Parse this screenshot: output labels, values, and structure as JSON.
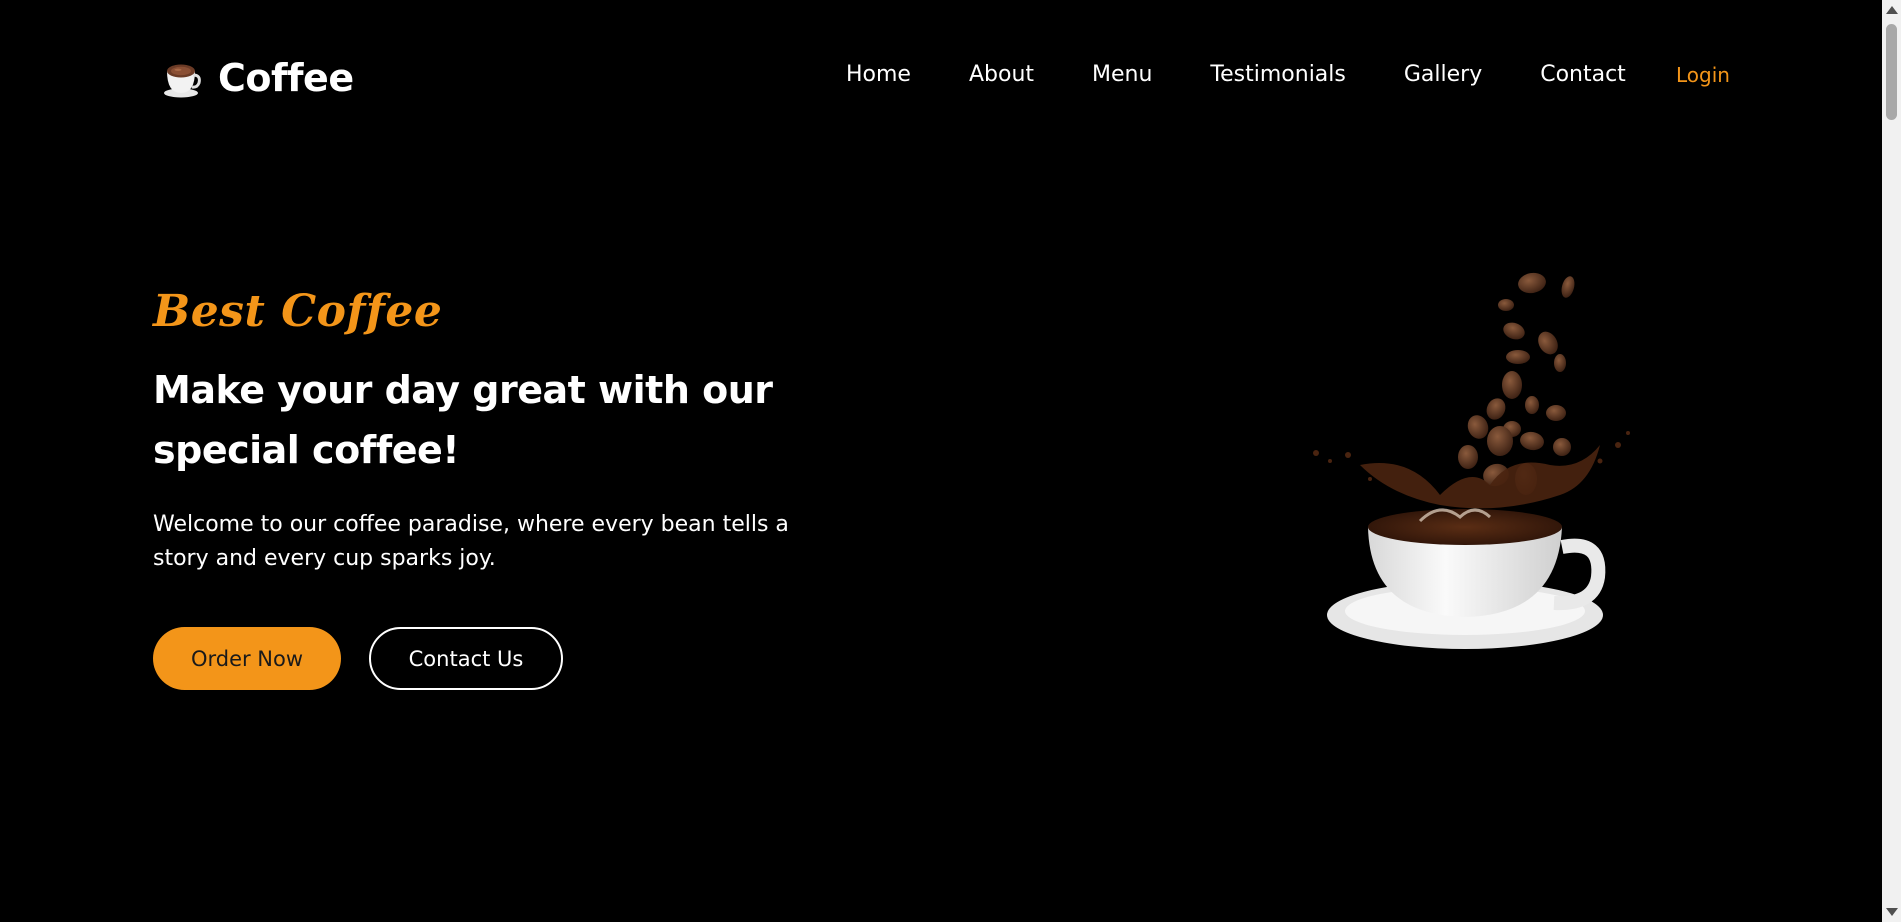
{
  "colors": {
    "background": "#000000",
    "accent": "#f39519",
    "text": "#ffffff"
  },
  "header": {
    "logo": {
      "icon": "coffee-cup-icon",
      "text": "Coffee"
    },
    "nav": [
      {
        "label": "Home"
      },
      {
        "label": "About"
      },
      {
        "label": "Menu"
      },
      {
        "label": "Testimonials"
      },
      {
        "label": "Gallery"
      },
      {
        "label": "Contact"
      }
    ],
    "login_label": "Login"
  },
  "hero": {
    "tagline": "Best Coffee",
    "title": "Make your day great with our special coffee!",
    "description": "Welcome to our coffee paradise, where every bean tells a story and every cup sparks joy.",
    "order_button": "Order Now",
    "contact_button": "Contact Us",
    "image": "coffee-cup-with-falling-beans-image"
  }
}
